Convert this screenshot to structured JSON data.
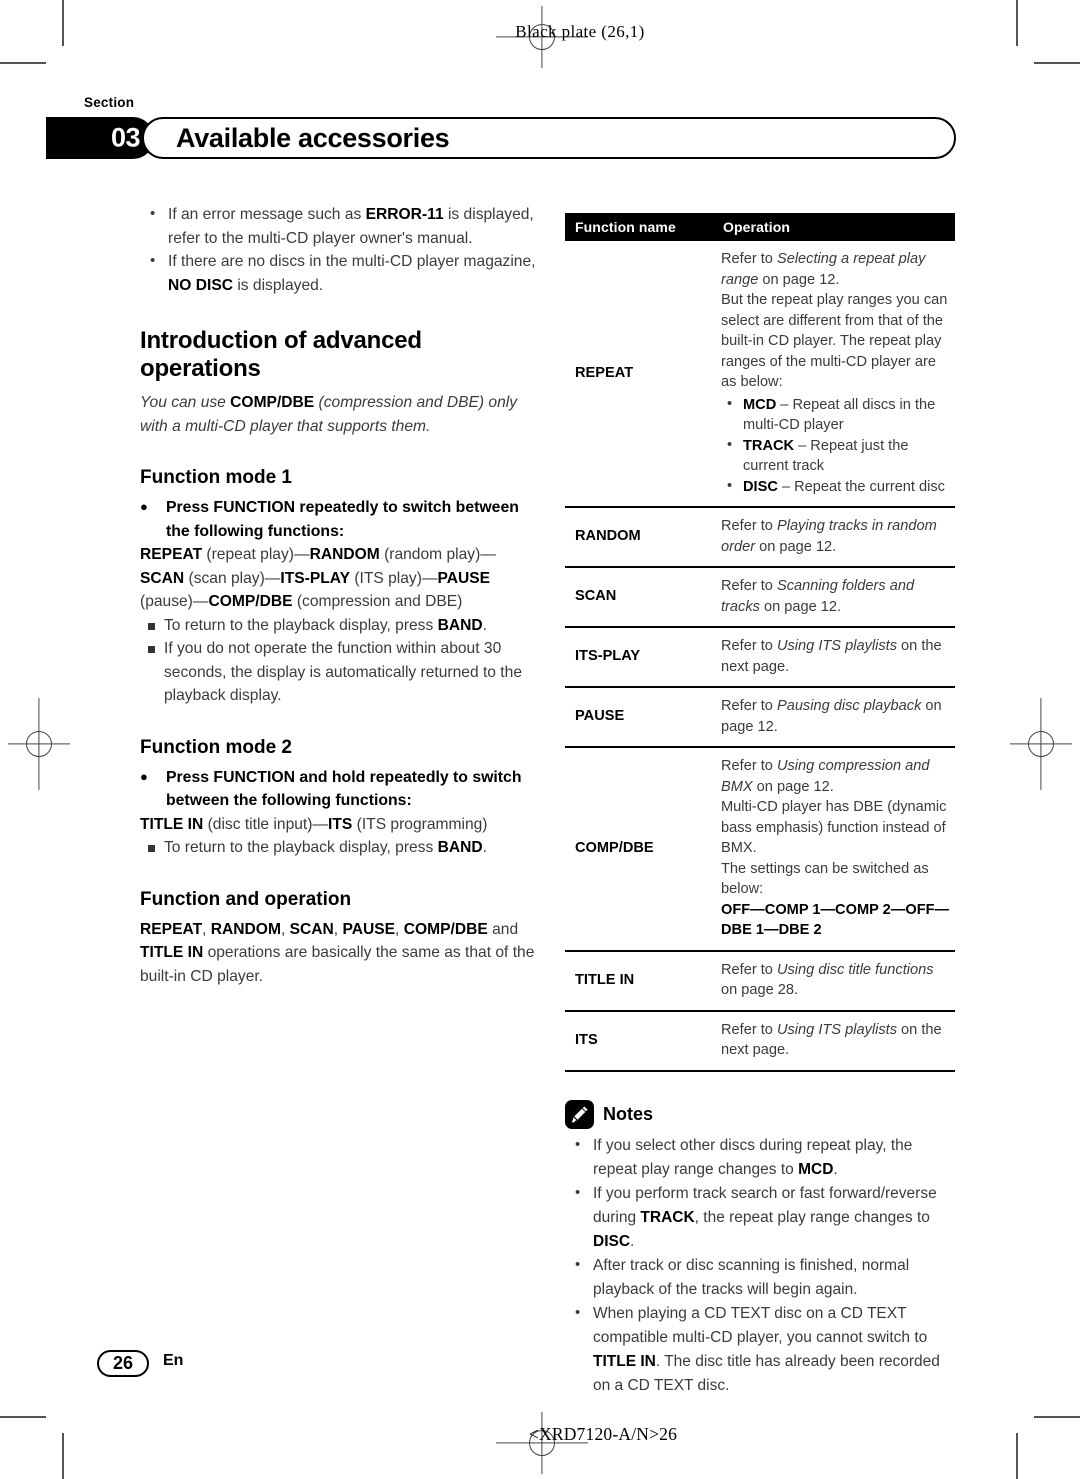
{
  "page": {
    "plate_marker": "Black plate (26,1)",
    "section_label": "Section",
    "section_number": "03",
    "section_title": "Available accessories",
    "page_number": "26",
    "language_code": "En",
    "document_id": "<XRD7120-A/N>26"
  },
  "left_column": {
    "top_bullets": [
      "If an error message such as ERROR-11 is displayed, refer to the multi-CD player owner's manual.",
      "If there are no discs in the multi-CD player magazine, NO DISC is displayed."
    ],
    "heading_intro": "Introduction of advanced operations",
    "intro_italic": "You can use COMP/DBE (compression and DBE) only with a multi-CD player that supports them.",
    "function_mode_1": {
      "heading": "Function mode 1",
      "instruction": "Press FUNCTION repeatedly to switch between the following functions:",
      "sequence": "REPEAT (repeat play)—RANDOM (random play)—SCAN (scan play)—ITS-PLAY (ITS play)—PAUSE (pause)—COMP/DBE (compression and DBE)",
      "notes": [
        "To return to the playback display, press BAND.",
        "If you do not operate the function within about 30 seconds, the display is automatically returned to the playback display."
      ]
    },
    "function_mode_2": {
      "heading": "Function mode 2",
      "instruction": "Press FUNCTION and hold repeatedly to switch between the following functions:",
      "sequence": "TITLE IN (disc title input)—ITS (ITS programming)",
      "notes": [
        "To return to the playback display, press BAND."
      ]
    },
    "function_and_operation": {
      "heading": "Function and operation",
      "body": "REPEAT, RANDOM, SCAN, PAUSE, COMP/DBE and TITLE IN operations are basically the same as that of the built-in CD player."
    }
  },
  "table": {
    "headers": [
      "Function name",
      "Operation"
    ],
    "rows": [
      {
        "name": "REPEAT",
        "lines": [
          "Refer to Selecting a repeat play range on page 12.",
          "But the repeat play ranges you can select are different from that of the built-in CD player. The repeat play ranges of the multi-CD player are as below:"
        ],
        "bullets": [
          "MCD – Repeat all discs in the multi-CD player",
          "TRACK – Repeat just the current track",
          "DISC – Repeat the current disc"
        ]
      },
      {
        "name": "RANDOM",
        "lines": [
          "Refer to Playing tracks in random order on page 12."
        ],
        "bullets": []
      },
      {
        "name": "SCAN",
        "lines": [
          "Refer to Scanning folders and tracks on page 12."
        ],
        "bullets": []
      },
      {
        "name": "ITS-PLAY",
        "lines": [
          "Refer to Using ITS playlists on the next page."
        ],
        "bullets": []
      },
      {
        "name": "PAUSE",
        "lines": [
          "Refer to Pausing disc playback on page 12."
        ],
        "bullets": []
      },
      {
        "name": "COMP/DBE",
        "lines": [
          "Refer to Using compression and BMX on page 12.",
          "Multi-CD player has DBE (dynamic bass emphasis) function instead of BMX.",
          "The settings can be switched as below:",
          "OFF—COMP 1—COMP 2—OFF—DBE 1—DBE 2"
        ],
        "bullets": []
      },
      {
        "name": "TITLE IN",
        "lines": [
          "Refer to Using disc title functions on page 28."
        ],
        "bullets": []
      },
      {
        "name": "ITS",
        "lines": [
          "Refer to Using ITS playlists on the next page."
        ],
        "bullets": []
      }
    ]
  },
  "notes": {
    "title": "Notes",
    "icon": "pencil-icon",
    "items": [
      "If you select other discs during repeat play, the repeat play range changes to MCD.",
      "If you perform track search or fast forward/reverse during TRACK, the repeat play range changes to DISC.",
      "After track or disc scanning is finished, normal playback of the tracks will begin again.",
      "When playing a CD TEXT disc on a CD TEXT compatible multi-CD player, you cannot switch to TITLE IN. The disc title has already been recorded on a CD TEXT disc."
    ]
  },
  "colors": {
    "ink": "#000000",
    "body_gray": "#3b3b3b",
    "mark_gray": "#555555"
  }
}
